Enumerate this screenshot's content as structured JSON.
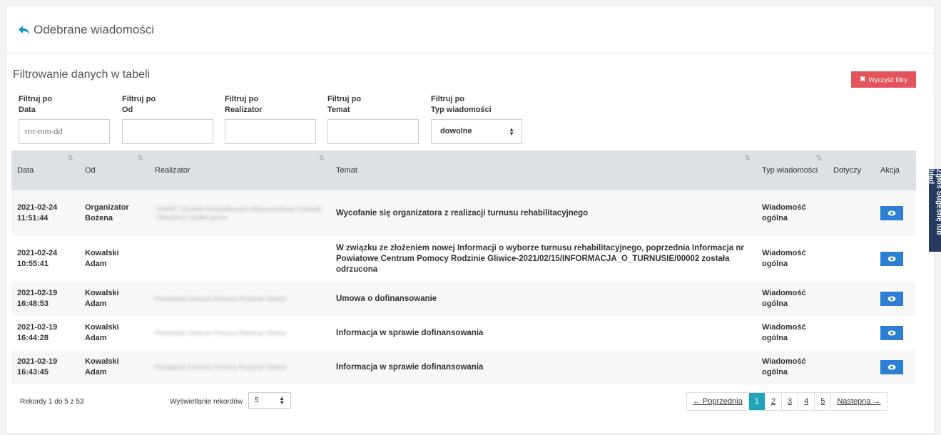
{
  "header": {
    "title": "Odebrane wiadomości"
  },
  "filters": {
    "title": "Filtrowanie danych w tabeli",
    "clear_label": "Wyczyść filtry",
    "fields": [
      {
        "label_1": "Filtruj po",
        "label_2": "Data",
        "placeholder": "rrrr-mm-dd"
      },
      {
        "label_1": "Filtruj po",
        "label_2": "Od",
        "placeholder": ""
      },
      {
        "label_1": "Filtruj po",
        "label_2": "Realizator",
        "placeholder": ""
      },
      {
        "label_1": "Filtruj po",
        "label_2": "Temat",
        "placeholder": ""
      },
      {
        "label_1": "Filtruj po",
        "label_2": "Typ wiadomości",
        "value": "dowolne"
      }
    ]
  },
  "table": {
    "headers": [
      "Data",
      "Od",
      "Realizator",
      "Temat",
      "Typ wiadomości",
      "Dotyczy",
      "Akcja"
    ],
    "rows": [
      {
        "date": "2021-02-24",
        "time": "11:51:44",
        "from_1": "Organizator",
        "from_2": "Bożena",
        "realizator": "\"ADAM\" Ośrodek Rehabilitacyjno Wypoczynkowy Chałupki i Wspólnicy Spółka jawna",
        "temat": "Wycofanie się organizatora z realizacji turnusu rehabilitacyjnego",
        "typ_1": "Wiadomość",
        "typ_2": "ogólna"
      },
      {
        "date": "2021-02-24",
        "time": "10:55:41",
        "from_1": "Kowalski",
        "from_2": "Adam",
        "realizator": "",
        "temat": "W związku ze złożeniem nowej Informacji o wyborze turnusu rehabilitacyjnego, poprzednia Informacja nr Powiatowe Centrum Pomocy Rodzinie Gliwice-2021/02/15/INFORMACJA_O_TURNUSIE/00002 została odrzucona",
        "typ_1": "Wiadomość",
        "typ_2": "ogólna"
      },
      {
        "date": "2021-02-19",
        "time": "16:48:53",
        "from_1": "Kowalski",
        "from_2": "Adam",
        "realizator": "Powiatowe Centrum Pomocy Rodzinie Gliwice",
        "temat": "Umowa o dofinansowanie",
        "typ_1": "Wiadomość",
        "typ_2": "ogólna"
      },
      {
        "date": "2021-02-19",
        "time": "16:44:28",
        "from_1": "Kowalski",
        "from_2": "Adam",
        "realizator": "Powiatowe Centrum Pomocy Rodzinie Gliwice",
        "temat": "Informacja w sprawie dofinansowania",
        "typ_1": "Wiadomość",
        "typ_2": "ogólna"
      },
      {
        "date": "2021-02-19",
        "time": "16:43:45",
        "from_1": "Kowalski",
        "from_2": "Adam",
        "realizator": "Powiatowe Centrum Pomocy Rodzinie Gliwice",
        "temat": "Informacja w sprawie dofinansowania",
        "typ_1": "Wiadomość",
        "typ_2": "ogólna"
      }
    ]
  },
  "footer": {
    "records_info": "Rekordy 1 do 5 z 53",
    "page_size_label": "Wyświetlanie rekordów",
    "page_size": "5",
    "prev": "← Poprzednia",
    "pages": [
      "1",
      "2",
      "3",
      "4",
      "5"
    ],
    "next": "Nastepna →"
  },
  "side_tab": {
    "label": "Zgłoś Sugestię lub błąd"
  },
  "colors": {
    "clear_button": "#e2535b",
    "eye_button": "#2d7fd3",
    "active_page": "#21a3b8",
    "side_tab": "#253a5e",
    "table_header": "#dde1e6"
  },
  "icons": {
    "back": "reply-arrow-icon",
    "eye": "eye-icon",
    "clear": "times-icon",
    "sort": "sort-icon"
  }
}
